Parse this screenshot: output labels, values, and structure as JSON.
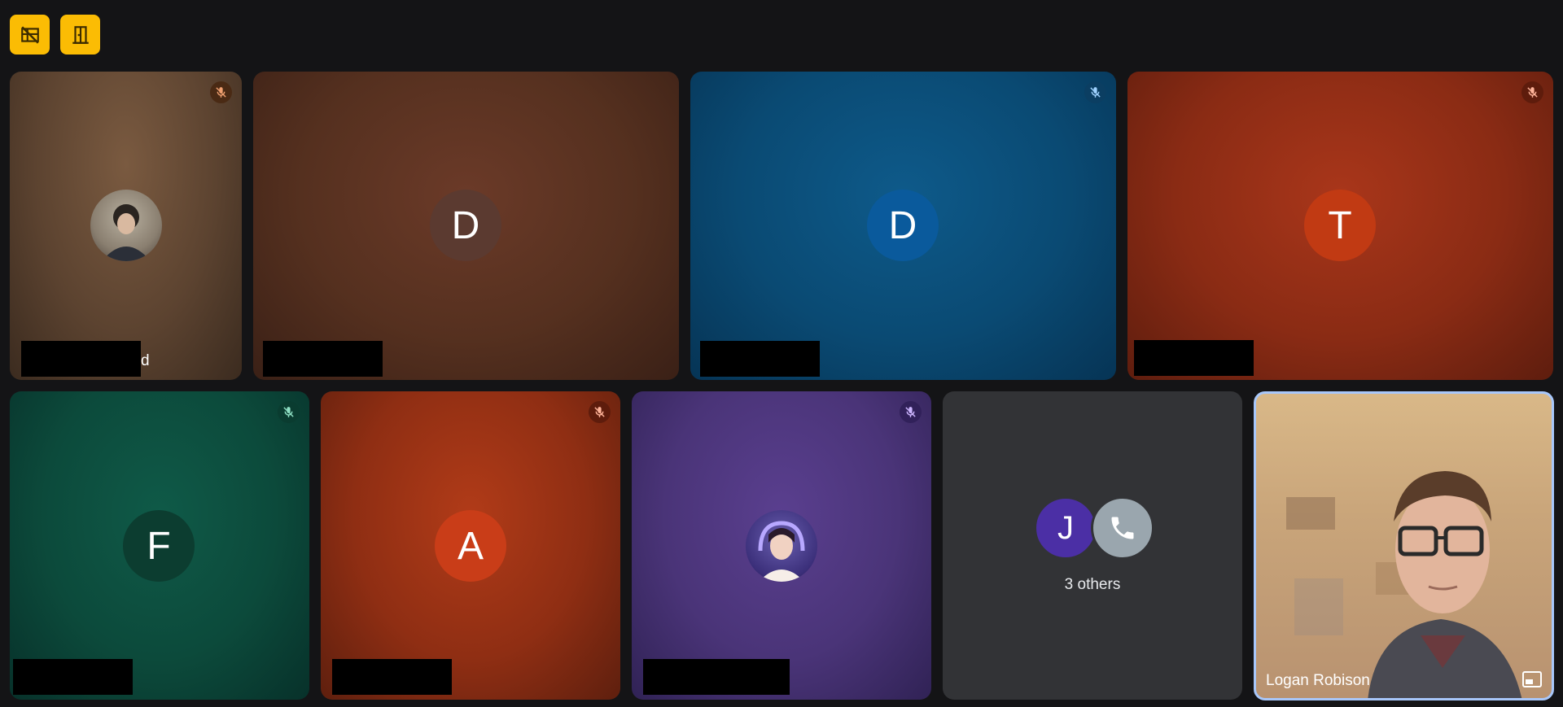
{
  "toolbar": {
    "button1_icon": "no-video-grid-icon",
    "button2_icon": "exit-door-icon",
    "accent_color": "#fbbc04"
  },
  "tiles": [
    {
      "initial": "",
      "partial_name": "d",
      "muted": true,
      "type": "photo"
    },
    {
      "initial": "D",
      "muted": false,
      "avatar_color": "#5b3a30"
    },
    {
      "initial": "D",
      "muted": true,
      "avatar_color": "#0a5a9c"
    },
    {
      "initial": "T",
      "muted": true,
      "avatar_color": "#c13a13"
    },
    {
      "initial": "F",
      "muted": true,
      "avatar_color": "#0c3d30"
    },
    {
      "initial": "A",
      "muted": true,
      "avatar_color": "#c93d18"
    },
    {
      "initial": "",
      "muted": true,
      "type": "photo"
    }
  ],
  "others": {
    "initial": "J",
    "label": "3 others",
    "avatar_color": "#4b2fa5",
    "phone_avatar_color": "#9aa6ae"
  },
  "self": {
    "name": "Logan Robison"
  }
}
